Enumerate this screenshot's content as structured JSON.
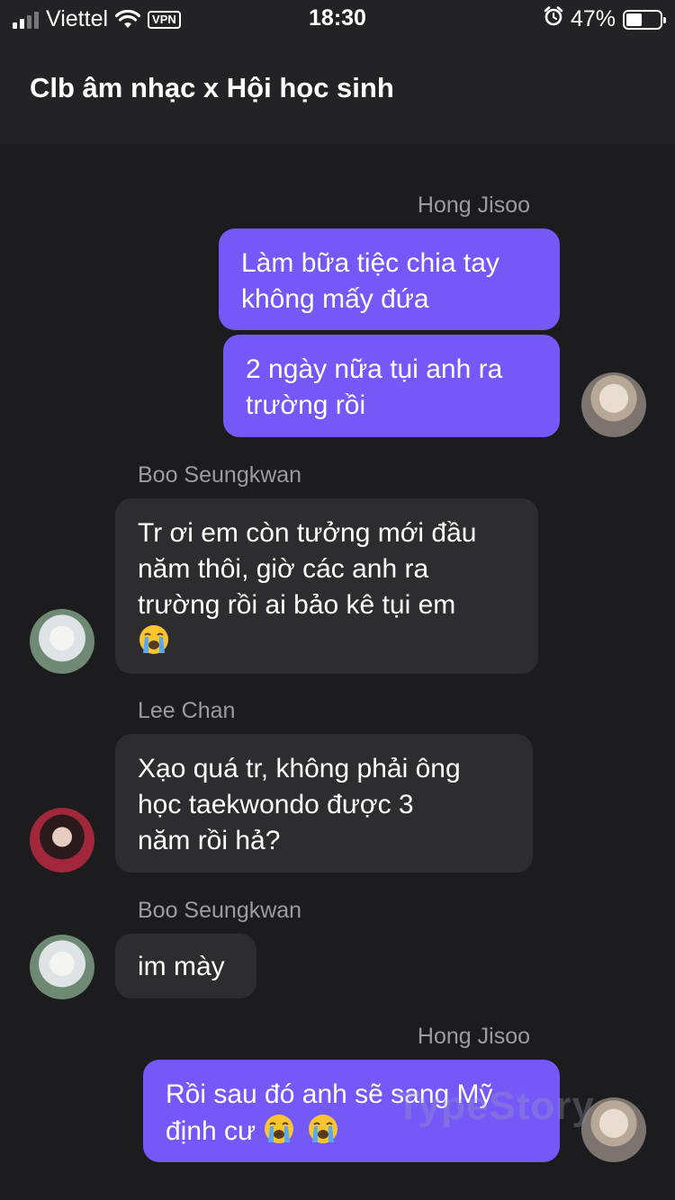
{
  "status_bar": {
    "carrier": "Viettel",
    "vpn": "VPN",
    "time": "18:30",
    "battery_percent": "47%",
    "battery_level": 0.47
  },
  "chat": {
    "title": "Clb âm nhạc x Hội học sinh"
  },
  "messages": [
    {
      "sender": "Hong Jisoo",
      "line1": "Làm bữa tiệc chia tay",
      "line2": "không mấy đứa"
    },
    {
      "line1": "2 ngày nữa tụi anh ra",
      "line2": "trường rồi"
    },
    {
      "sender": "Boo Seungkwan",
      "line1": "Tr ơi em còn tưởng mới đầu",
      "line2": "năm thôi, giờ các anh ra",
      "line3": "trường rồi ai bảo kê tụi em"
    },
    {
      "sender": "Lee Chan",
      "line1": "Xạo quá tr, không phải ông",
      "line2": "học taekwondo được 3",
      "line3": "năm rồi hả?"
    },
    {
      "sender": "Boo Seungkwan",
      "line1": "im mày"
    },
    {
      "sender": "Hong Jisoo",
      "line1": "Rồi sau đó anh sẽ sang Mỹ",
      "line2": "định cư"
    }
  ],
  "watermark": "TypeStory",
  "icons": {
    "crying": "loudly-crying-face-emoji",
    "alarm": "alarm-clock-icon",
    "wifi": "wifi-icon",
    "signal": "signal-bars-icon",
    "battery": "battery-icon"
  },
  "colors": {
    "outgoing_bubble": "#7458f8",
    "incoming_bubble": "#2d2d30",
    "background": "#1c1c1e",
    "header": "#232325",
    "sender_name": "#9b9ba0"
  }
}
